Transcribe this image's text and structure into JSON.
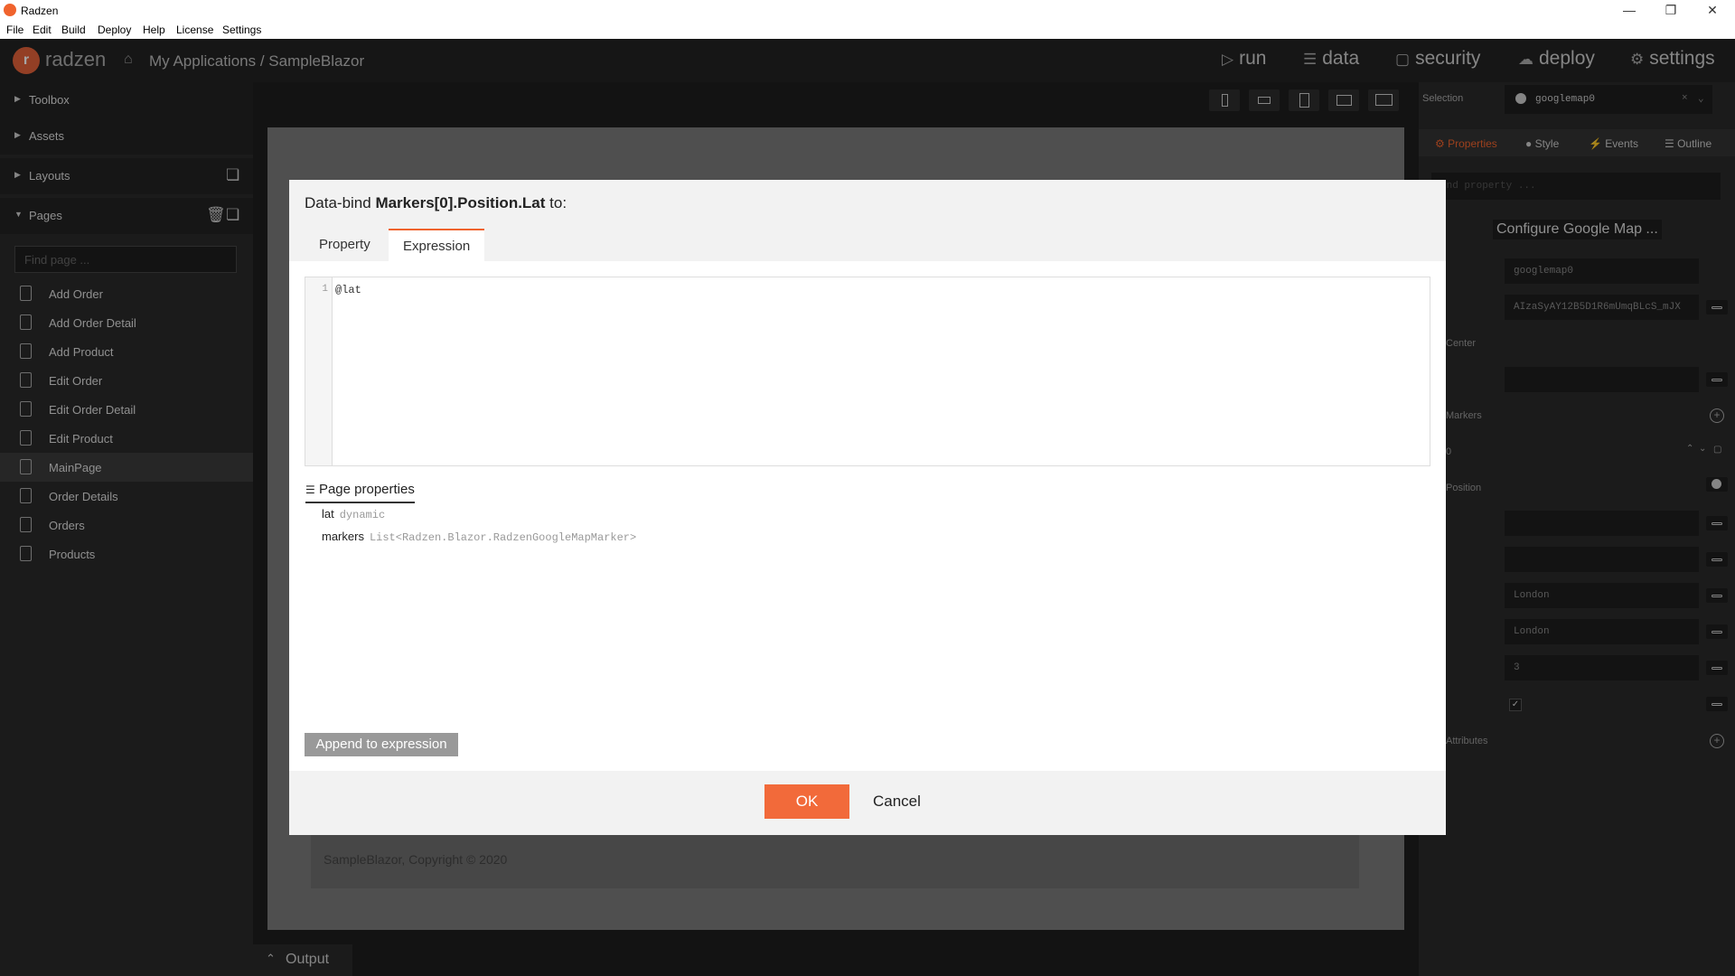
{
  "window": {
    "title": "Radzen",
    "menu": [
      "File",
      "Edit",
      "Build",
      "Deploy",
      "Help",
      "License",
      "Settings"
    ]
  },
  "header": {
    "brand": "radzen",
    "breadcrumb": "My Applications / SampleBlazor",
    "nav": [
      {
        "label": "run",
        "icon": "play-icon"
      },
      {
        "label": "data",
        "icon": "layers-icon"
      },
      {
        "label": "security",
        "icon": "lock-icon"
      },
      {
        "label": "deploy",
        "icon": "cloud-upload-icon"
      },
      {
        "label": "settings",
        "icon": "gear-icon"
      }
    ]
  },
  "sidebar": {
    "sections": [
      "Toolbox",
      "Assets",
      "Layouts",
      "Pages"
    ],
    "find_placeholder": "Find page ...",
    "pages": [
      "Add Order",
      "Add Order Detail",
      "Add Product",
      "Edit Order",
      "Edit Order Detail",
      "Edit Product",
      "MainPage",
      "Order Details",
      "Orders",
      "Products"
    ],
    "active_page": "MainPage"
  },
  "canvas": {
    "footer_text": "SampleBlazor, Copyright © 2020",
    "output_label": "Output"
  },
  "right_panel": {
    "selection_label": "Selection",
    "selection_value": "googlemap0",
    "tabs": [
      "Properties",
      "Style",
      "Events",
      "Outline"
    ],
    "find_property_placeholder": "ind property ...",
    "configure_button": "Configure Google Map ...",
    "fields": {
      "name": "googlemap0",
      "api_key": "AIzaSyAY12B5D1R6mUmqBLcS_mJX",
      "center_label": "Center",
      "markers_label": "Markers",
      "marker_index": "0",
      "position_label": "Position",
      "title1": "London",
      "title2": "London",
      "zoom": "3",
      "attributes_label": "Attributes"
    }
  },
  "dialog": {
    "title_prefix": "Data-bind ",
    "title_bold": "Markers[0].Position.Lat",
    "title_suffix": " to:",
    "tabs": [
      "Property",
      "Expression"
    ],
    "active_tab": "Expression",
    "editor": {
      "line_number": "1",
      "code": "@lat"
    },
    "page_properties_label": "Page properties",
    "properties": [
      {
        "name": "lat",
        "type": "dynamic"
      },
      {
        "name": "markers",
        "type": "List<Radzen.Blazor.RadzenGoogleMapMarker>"
      }
    ],
    "append_label": "Append to expression",
    "ok_label": "OK",
    "cancel_label": "Cancel"
  },
  "colors": {
    "accent": "#f0632d",
    "dark_bg": "#1e1e1e",
    "panel_bg": "#2a2a2a"
  }
}
